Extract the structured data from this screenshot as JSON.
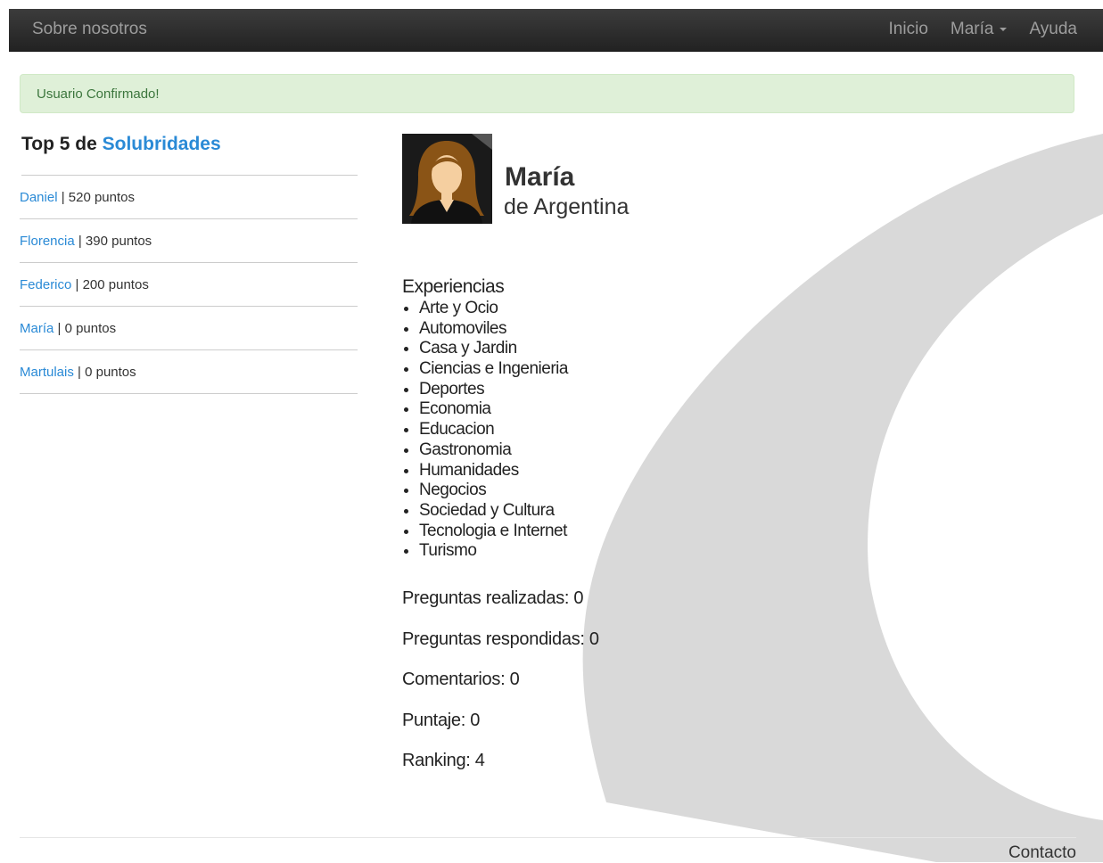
{
  "navbar": {
    "brand": "Sobre nosotros",
    "items": [
      {
        "label": "Inicio"
      },
      {
        "label": "María"
      },
      {
        "label": "Ayuda"
      }
    ]
  },
  "alert": {
    "text": "Usuario Confirmado!"
  },
  "sidebar": {
    "title_prefix": "Top 5 de ",
    "title_brand": "Solubridades",
    "ranking": [
      {
        "name": "Daniel",
        "points": " | 520 puntos"
      },
      {
        "name": "Florencia",
        "points": " | 390 puntos"
      },
      {
        "name": "Federico",
        "points": " | 200 puntos"
      },
      {
        "name": "María",
        "points": " | 0 puntos"
      },
      {
        "name": "Martulais",
        "points": " | 0 puntos"
      }
    ]
  },
  "profile": {
    "name": "María",
    "country": "de Argentina",
    "avatar_icon": "female-avatar-icon"
  },
  "experiences": {
    "title": "Experiencias",
    "items": [
      "Arte y Ocio",
      "Automoviles",
      "Casa y Jardin",
      "Ciencias e Ingenieria",
      "Deportes",
      "Economia",
      "Educacion",
      "Gastronomia",
      "Humanidades",
      "Negocios",
      "Sociedad y Cultura",
      "Tecnologia e Internet",
      "Turismo"
    ]
  },
  "stats": {
    "preguntas_realizadas": "Preguntas realizadas: 0",
    "preguntas_respondidas": "Preguntas respondidas: 0",
    "comentarios": "Comentarios: 0",
    "puntaje": "Puntaje: 0",
    "ranking": "Ranking: 4"
  },
  "footer": {
    "contact": "Contacto"
  },
  "colors": {
    "navbar": "#222222",
    "link": "#2a8ad6",
    "alert_bg": "#dff0d8",
    "alert_text": "#3c763d",
    "arc": "#d9d9d9"
  }
}
